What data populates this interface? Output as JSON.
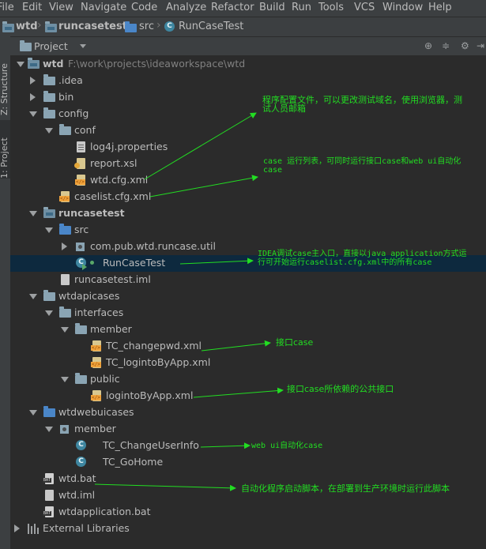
{
  "menu": [
    "File",
    "Edit",
    "View",
    "Navigate",
    "Code",
    "Analyze",
    "Refactor",
    "Build",
    "Run",
    "Tools",
    "VCS",
    "Window",
    "Help"
  ],
  "breadcrumb": [
    "wtd",
    "runcasetest",
    "src",
    "RunCaseTest"
  ],
  "side_tabs": [
    "Z: Structure",
    "1: Project"
  ],
  "panel": {
    "title": "Project"
  },
  "tree": [
    {
      "label": "wtd",
      "path": "F:\\work\\projects\\ideaworkspace\\wtd"
    },
    {
      "label": ".idea"
    },
    {
      "label": "bin"
    },
    {
      "label": "config"
    },
    {
      "label": "conf"
    },
    {
      "label": "log4j.properties"
    },
    {
      "label": "report.xsl"
    },
    {
      "label": "wtd.cfg.xml"
    },
    {
      "label": "caselist.cfg.xml"
    },
    {
      "label": "runcasetest"
    },
    {
      "label": "src"
    },
    {
      "label": "com.pub.wtd.runcase.util"
    },
    {
      "label": "RunCaseTest"
    },
    {
      "label": "runcasetest.iml"
    },
    {
      "label": "wtdapicases"
    },
    {
      "label": "interfaces"
    },
    {
      "label": "member"
    },
    {
      "label": "TC_changepwd.xml"
    },
    {
      "label": "TC_logintoByApp.xml"
    },
    {
      "label": "public"
    },
    {
      "label": "logintoByApp.xml"
    },
    {
      "label": "wtdwebuicases"
    },
    {
      "label": "member"
    },
    {
      "label": "TC_ChangeUserInfo"
    },
    {
      "label": "TC_GoHome"
    },
    {
      "label": "wtd.bat"
    },
    {
      "label": "wtd.iml"
    },
    {
      "label": "wtdapplication.bat"
    },
    {
      "label": "External Libraries"
    }
  ],
  "notes": {
    "config": [
      "程序配置文件，可以更改测试域名，使用浏览器，测",
      "试人员邮箱"
    ],
    "caselist": [
      "case 运行列表，可同时运行接口case和web ui自动化",
      "case"
    ],
    "runcase": [
      "IDEA调试case主入口，直接以java application方式运",
      "行可开始运行caselist.cfg.xml中的所有case"
    ],
    "api_case": "接口case",
    "public_api": "接口case所依赖的公共接口",
    "webui": "web ui自动化case",
    "bat": "自动化程序启动脚本，在部署到生产环境时运行此脚本"
  },
  "colors": {
    "annotation": "#22dd22",
    "tree_bg": "#2b2b2b",
    "chrome_bg": "#3c3f41",
    "selection": "#0d293e"
  }
}
